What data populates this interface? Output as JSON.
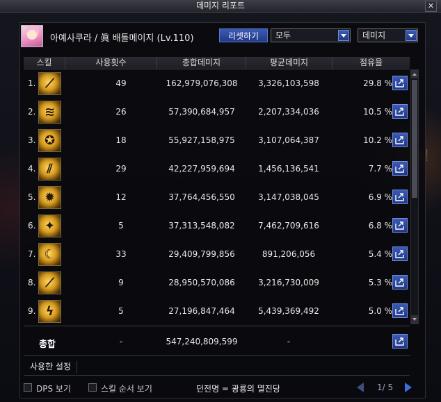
{
  "window": {
    "title": "데미지 리포트",
    "close_label": "✕"
  },
  "character": {
    "name": "아예사쿠라 / 眞 배틀메이지 (Lv.110)"
  },
  "controls": {
    "reset_label": "리셋하기",
    "filter_value": "모두",
    "metric_value": "데미지"
  },
  "table": {
    "headers": [
      "스킬",
      "사용횟수",
      "총합데미지",
      "평균데미지",
      "점유율"
    ],
    "rows": [
      {
        "rank": "1.",
        "icon": "staff-strike-icon",
        "count": "49",
        "total": "162,979,076,308",
        "avg": "3,326,103,598",
        "share": "29.8 %"
      },
      {
        "rank": "2.",
        "icon": "swirl-wind-icon",
        "count": "26",
        "total": "57,390,684,957",
        "avg": "2,207,334,036",
        "share": "10.5 %"
      },
      {
        "rank": "3.",
        "icon": "star-orb-icon",
        "count": "18",
        "total": "55,927,158,975",
        "avg": "3,107,064,387",
        "share": "10.2 %"
      },
      {
        "rank": "4.",
        "icon": "claw-slash-icon",
        "count": "29",
        "total": "42,227,959,694",
        "avg": "1,456,136,541",
        "share": "7.7 %"
      },
      {
        "rank": "5.",
        "icon": "flame-burst-icon",
        "count": "12",
        "total": "37,764,456,550",
        "avg": "3,147,038,045",
        "share": "6.9 %"
      },
      {
        "rank": "6.",
        "icon": "spark-explosion-icon",
        "count": "5",
        "total": "37,313,548,082",
        "avg": "7,462,709,616",
        "share": "6.8 %"
      },
      {
        "rank": "7.",
        "icon": "moon-crescent-icon",
        "count": "33",
        "total": "29,409,799,856",
        "avg": "891,206,056",
        "share": "5.4 %"
      },
      {
        "rank": "8.",
        "icon": "staff-spin-icon",
        "count": "9",
        "total": "28,950,570,086",
        "avg": "3,216,730,009",
        "share": "5.3 %"
      },
      {
        "rank": "9.",
        "icon": "lightning-dash-icon",
        "count": "5",
        "total": "27,196,847,464",
        "avg": "5,439,369,492",
        "share": "5.0 %"
      }
    ],
    "total": {
      "label": "총합",
      "count": "-",
      "total": "547,240,809,599",
      "avg": "-"
    }
  },
  "settings": {
    "label": "사용한 설정"
  },
  "footer": {
    "dps_label": "DPS 보기",
    "skill_order_label": "스킬 순서 보기",
    "dungeon": "던전명 = 광룡의 멸진당",
    "page": "1/ 5"
  }
}
